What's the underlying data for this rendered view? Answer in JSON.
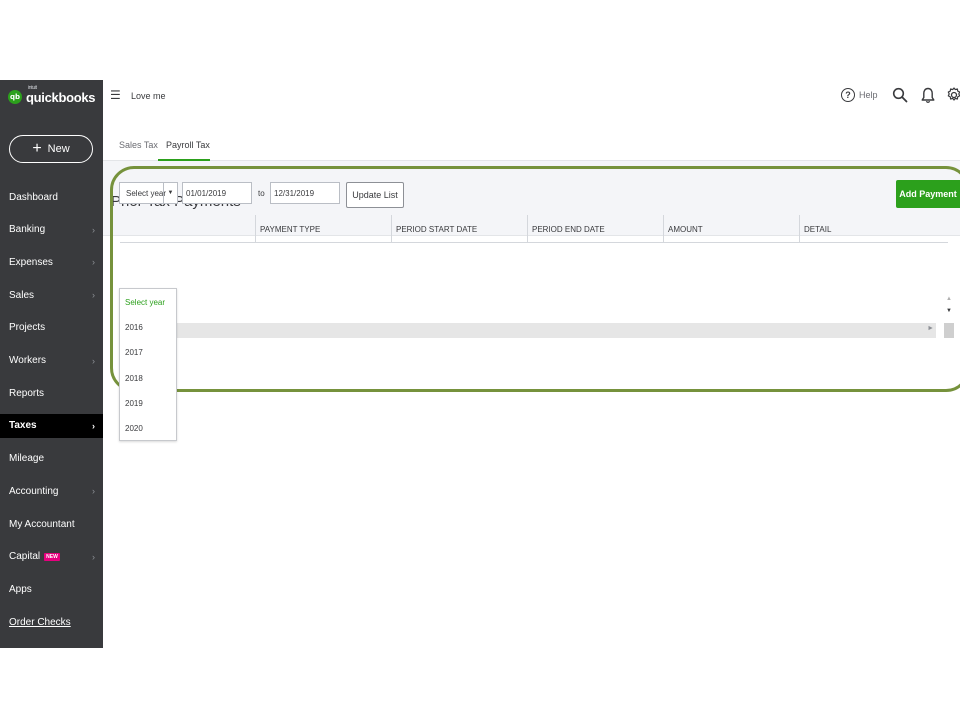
{
  "app": {
    "brand_prefix": "intuit",
    "brand": "quickbooks",
    "logo_badge": "qb"
  },
  "sidebar": {
    "new_button": "New",
    "items": [
      {
        "label": "Dashboard",
        "chevron": false
      },
      {
        "label": "Banking",
        "chevron": true
      },
      {
        "label": "Expenses",
        "chevron": true
      },
      {
        "label": "Sales",
        "chevron": true
      },
      {
        "label": "Projects",
        "chevron": false
      },
      {
        "label": "Workers",
        "chevron": true
      },
      {
        "label": "Reports",
        "chevron": false
      },
      {
        "label": "Taxes",
        "chevron": true,
        "active": true
      },
      {
        "label": "Mileage",
        "chevron": false
      },
      {
        "label": "Accounting",
        "chevron": true
      },
      {
        "label": "My Accountant",
        "chevron": false
      },
      {
        "label": "Capital",
        "chevron": true,
        "badge": "NEW"
      },
      {
        "label": "Apps",
        "chevron": false
      },
      {
        "label": "Order Checks",
        "chevron": false,
        "underlined": true
      }
    ]
  },
  "header": {
    "company": "Love me",
    "help": "Help"
  },
  "tabs": [
    {
      "label": "Sales Tax"
    },
    {
      "label": "Payroll Tax",
      "active": true
    }
  ],
  "page": {
    "title": "Prior Tax Payments"
  },
  "filters": {
    "year_select": "Select year",
    "date_from": "01/01/2019",
    "to_label": "to",
    "date_to": "12/31/2019",
    "update_button": "Update List",
    "add_payment": "Add Payment"
  },
  "table": {
    "columns": [
      "PAYMENT TYPE",
      "PERIOD START DATE",
      "PERIOD END DATE",
      "AMOUNT",
      "DETAIL"
    ]
  },
  "year_dropdown": {
    "options": [
      "Select year",
      "2016",
      "2017",
      "2018",
      "2019",
      "2020"
    ],
    "selected": "Select year"
  },
  "colors": {
    "sidebar": "#393a3d",
    "accent": "#2ca01c",
    "highlight": "#76923c",
    "active_nav": "#000000"
  }
}
